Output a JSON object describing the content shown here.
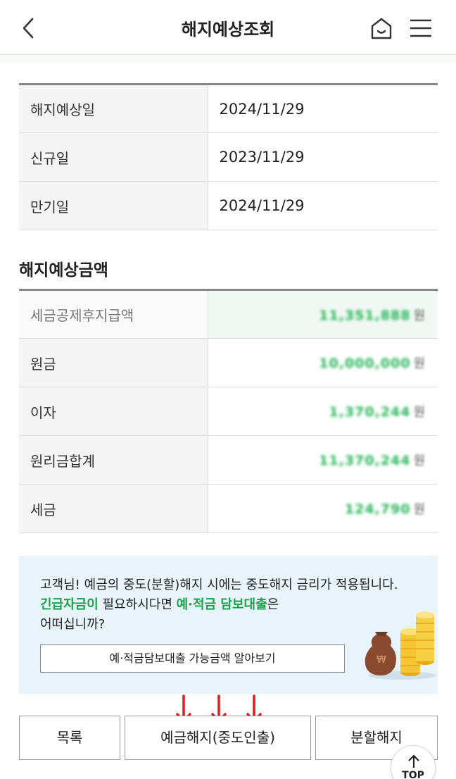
{
  "header": {
    "title": "해지예상조회",
    "back_icon": "chevron-left-icon",
    "home_icon": "home-icon",
    "menu_icon": "hamburger-menu-icon"
  },
  "dates": [
    {
      "label": "해지예상일",
      "value": "2024/11/29"
    },
    {
      "label": "신규일",
      "value": "2023/11/29"
    },
    {
      "label": "만기일",
      "value": "2024/11/29"
    }
  ],
  "amount_section": {
    "title": "해지예상금액",
    "rows": [
      {
        "label": "세금공제후지급액",
        "value": "11,351,888",
        "unit": "원"
      },
      {
        "label": "원금",
        "value": "10,000,000",
        "unit": "원"
      },
      {
        "label": "이자",
        "value": "1,370,244",
        "unit": "원"
      },
      {
        "label": "원리금합계",
        "value": "11,370,244",
        "unit": "원"
      },
      {
        "label": "세금",
        "value": "124,790",
        "unit": "원"
      }
    ]
  },
  "notice": {
    "line1": "고객님! 예금의 중도(분할)해지 시에는 중도해지 금리가 적용됩니다.",
    "line2_green1": "긴급자금이",
    "line2_mid": " 필요하시다면 ",
    "line2_green2": "예·적금 담보대출",
    "line2_end": "은",
    "line3": "어떠십니까?",
    "link_label": "예·적금담보대출 가능금액 알아보기",
    "accent_color": "#1aa14b"
  },
  "buttons": {
    "list": "목록",
    "cancel_deposit": "예금해지(중도인출)",
    "partial_cancel": "분할해지"
  },
  "top_button": {
    "label": "TOP"
  }
}
